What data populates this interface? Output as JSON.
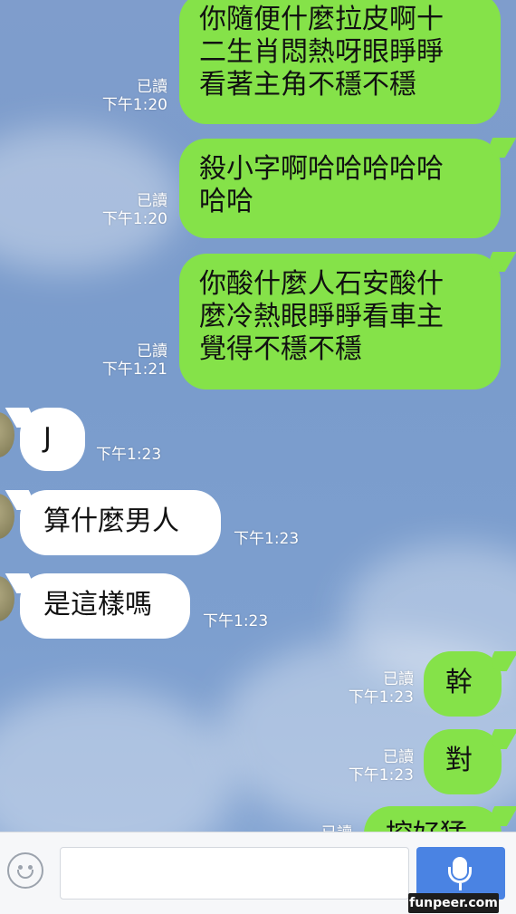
{
  "messages": [
    {
      "direction": "out",
      "lines": [
        "你隨便什麼拉皮啊十",
        "二生肖悶熱呀眼睜睜",
        "看著主角不穩不穩"
      ],
      "read": "已讀",
      "time": "下午1:20"
    },
    {
      "direction": "out",
      "lines": [
        "殺小字啊哈哈哈哈哈",
        "哈哈"
      ],
      "read": "已讀",
      "time": "下午1:20"
    },
    {
      "direction": "out",
      "lines": [
        "你酸什麼人石安酸什",
        "麼冷熱眼睜睜看車主",
        "覺得不穩不穩"
      ],
      "read": "已讀",
      "time": "下午1:21"
    },
    {
      "direction": "in",
      "lines": [
        "J"
      ],
      "time": "下午1:23"
    },
    {
      "direction": "in",
      "lines": [
        "算什麼男人"
      ],
      "time": "下午1:23"
    },
    {
      "direction": "in",
      "lines": [
        "是這樣嗎"
      ],
      "time": "下午1:23"
    },
    {
      "direction": "out",
      "lines": [
        "幹"
      ],
      "read": "已讀",
      "time": "下午1:23"
    },
    {
      "direction": "out",
      "lines": [
        "對"
      ],
      "read": "已讀",
      "time": "下午1:23"
    },
    {
      "direction": "out",
      "lines": [
        "挖好猛"
      ],
      "read": "已讀"
    }
  ],
  "composer": {
    "emoji_icon": "smiley-face-icon",
    "input_value": "",
    "mic_icon": "microphone-icon"
  },
  "colors": {
    "outgoing_bubble": "#85e249",
    "incoming_bubble": "#ffffff",
    "mic_button": "#4a83e3"
  },
  "watermark": "funpeer.com"
}
